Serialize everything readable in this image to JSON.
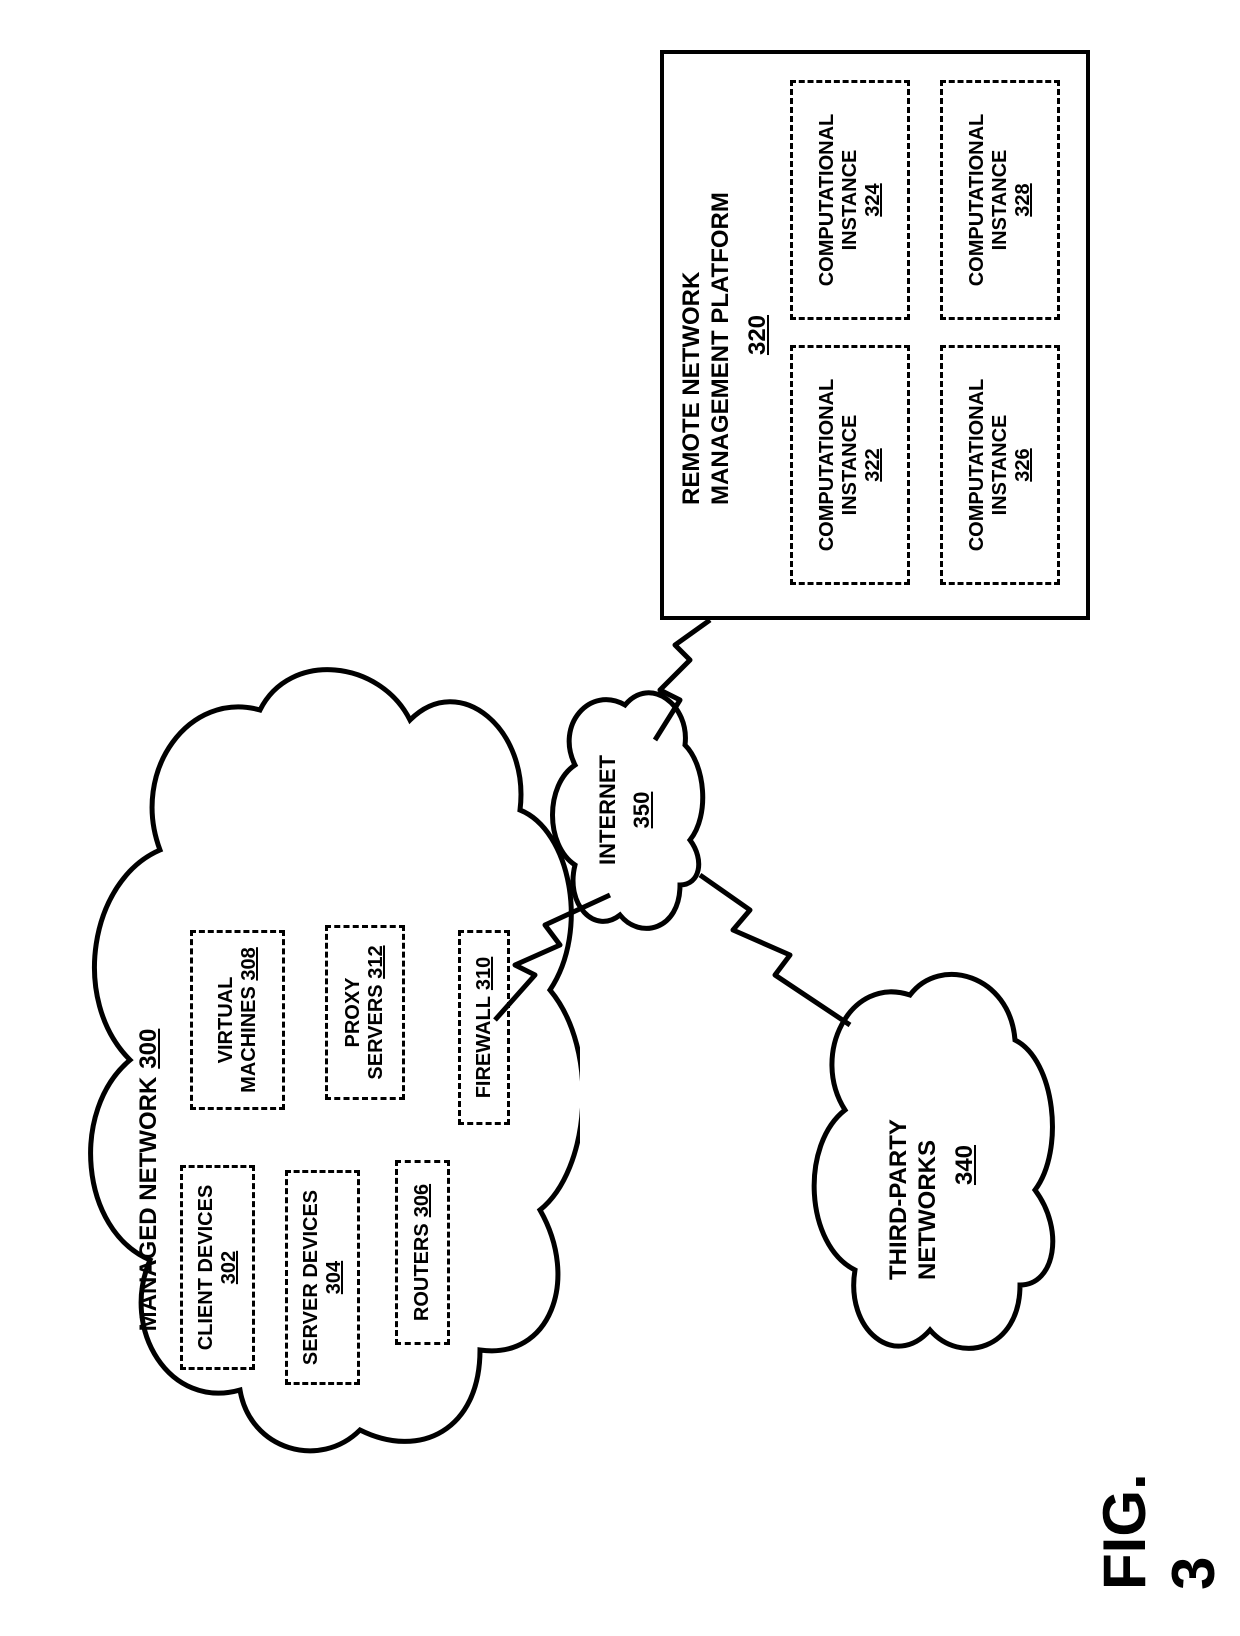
{
  "figure_label": "FIG. 3",
  "managed_network": {
    "title": "MANAGED NETWORK",
    "ref": "300",
    "boxes": {
      "client_devices": {
        "label": "CLIENT DEVICES",
        "ref": "302"
      },
      "server_devices": {
        "label": "SERVER DEVICES",
        "ref": "304"
      },
      "routers": {
        "label": "ROUTERS",
        "ref": "306"
      },
      "virtual_machines": {
        "label": "VIRTUAL MACHINES",
        "ref": "308"
      },
      "proxy_servers": {
        "label": "PROXY SERVERS",
        "ref": "312"
      },
      "firewall": {
        "label": "FIREWALL",
        "ref": "310"
      }
    }
  },
  "internet": {
    "label": "INTERNET",
    "ref": "350"
  },
  "third_party": {
    "label": "THIRD-PARTY NETWORKS",
    "ref": "340"
  },
  "platform": {
    "title": "REMOTE NETWORK MANAGEMENT PLATFORM",
    "ref": "320",
    "instances": {
      "a": {
        "label": "COMPUTATIONAL INSTANCE",
        "ref": "322"
      },
      "b": {
        "label": "COMPUTATIONAL INSTANCE",
        "ref": "324"
      },
      "c": {
        "label": "COMPUTATIONAL INSTANCE",
        "ref": "326"
      },
      "d": {
        "label": "COMPUTATIONAL INSTANCE",
        "ref": "328"
      }
    }
  }
}
